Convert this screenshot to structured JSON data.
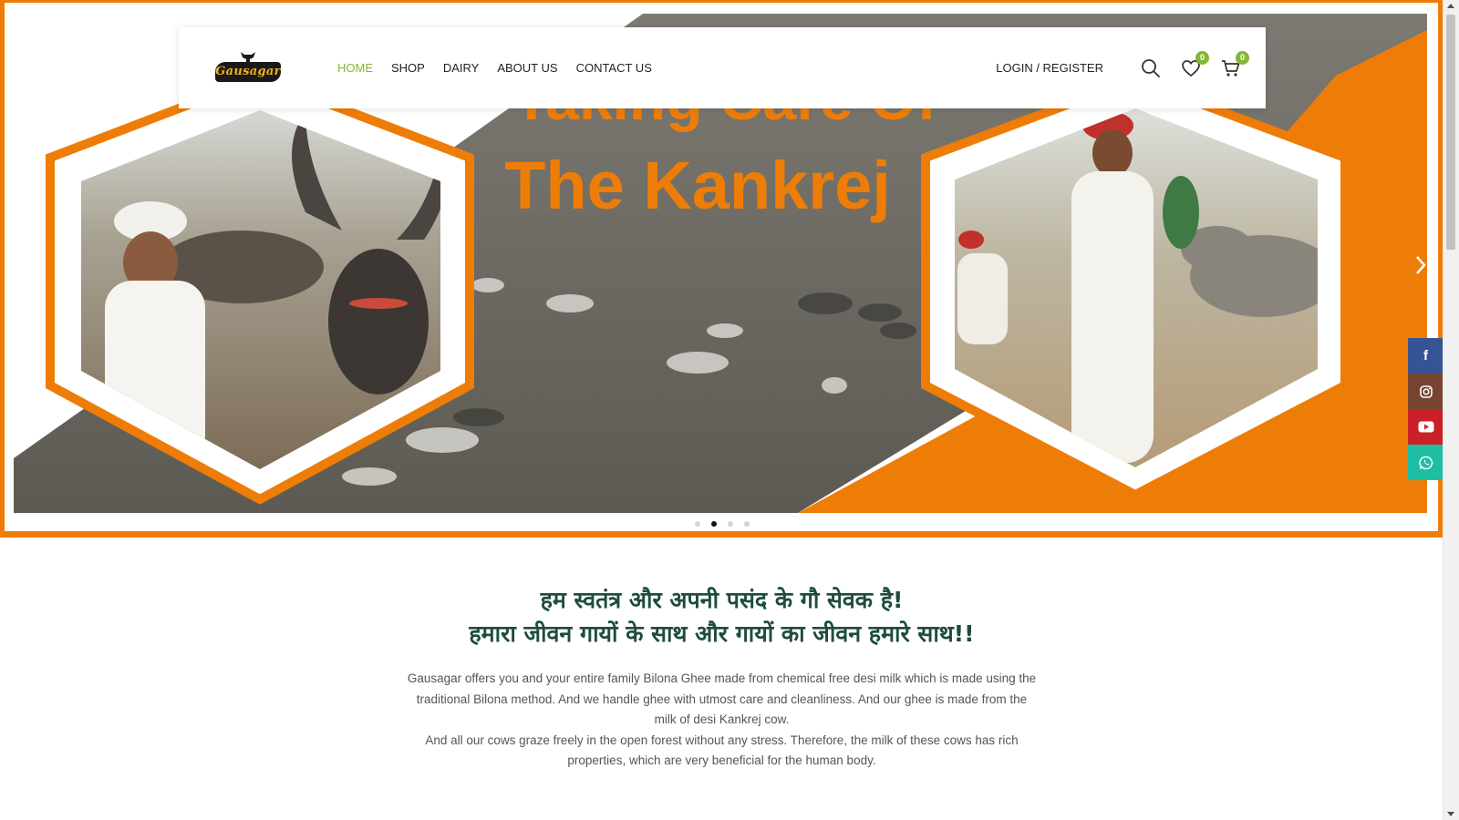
{
  "header": {
    "logo_text": "Gausagar",
    "nav": [
      {
        "label": "HOME",
        "active": true
      },
      {
        "label": "SHOP",
        "active": false
      },
      {
        "label": "DAIRY",
        "active": false
      },
      {
        "label": "ABOUT US",
        "active": false
      },
      {
        "label": "CONTACT US",
        "active": false
      }
    ],
    "login_label": "LOGIN / REGISTER",
    "wishlist_count": "0",
    "cart_count": "0",
    "icons": [
      "search-icon",
      "heart-icon",
      "cart-icon"
    ],
    "accent_color": "#83b735"
  },
  "hero": {
    "banner_title_line1": "Taking Care Of",
    "banner_title_line2": "The Kankrej",
    "accent_color": "#ee7d08",
    "slides_total": 4,
    "active_slide": 2
  },
  "social": [
    {
      "name": "facebook",
      "glyph": "f",
      "color": "#365493"
    },
    {
      "name": "instagram",
      "glyph": "◎",
      "color": "#774430"
    },
    {
      "name": "youtube",
      "glyph": "▶",
      "color": "#cb2027"
    },
    {
      "name": "whatsapp",
      "glyph": "✆",
      "color": "#1ebea5"
    }
  ],
  "intro": {
    "heading_line1": "हम स्वतंत्र और अपनी पसंद के गौ सेवक है!",
    "heading_line2": "हमारा जीवन गायों के साथ और गायों का जीवन हमारे साथ!!",
    "paragraph1": "Gausagar offers you and your entire family Bilona Ghee made from chemical free desi milk which is made using the traditional Bilona method. And we handle ghee with utmost care and cleanliness. And our ghee is made from the milk of desi Kankrej cow.",
    "paragraph2": "And all our cows graze freely in the open forest without any stress. Therefore, the milk of these cows has rich properties, which are very beneficial for the human body.",
    "heading_color": "#1e4d3a"
  }
}
